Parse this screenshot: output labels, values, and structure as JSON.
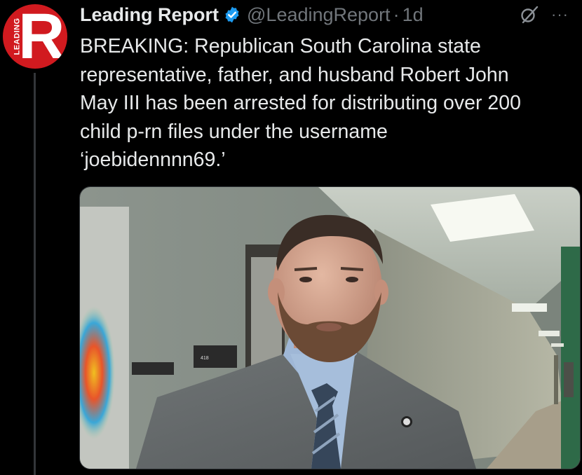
{
  "author": {
    "display_name": "Leading Report",
    "handle": "@LeadingReport",
    "separator": "·",
    "time_ago": "1d",
    "avatar_letter": "R",
    "avatar_side_text": "LEADING",
    "avatar_color": "#d11a1f",
    "verified_color": "#1d9bf0"
  },
  "actions": {
    "grok_icon": "grok-icon",
    "more_label": "···"
  },
  "tweet": {
    "lines": [
      "BREAKING: Republican South Carolina state",
      "representative, father, and husband Robert John",
      "May III has been arrested for distributing over 200",
      "child p-rn files under the username",
      "‘joebidennnn69.’"
    ]
  },
  "media": {
    "type": "photo",
    "room_number": "418"
  }
}
